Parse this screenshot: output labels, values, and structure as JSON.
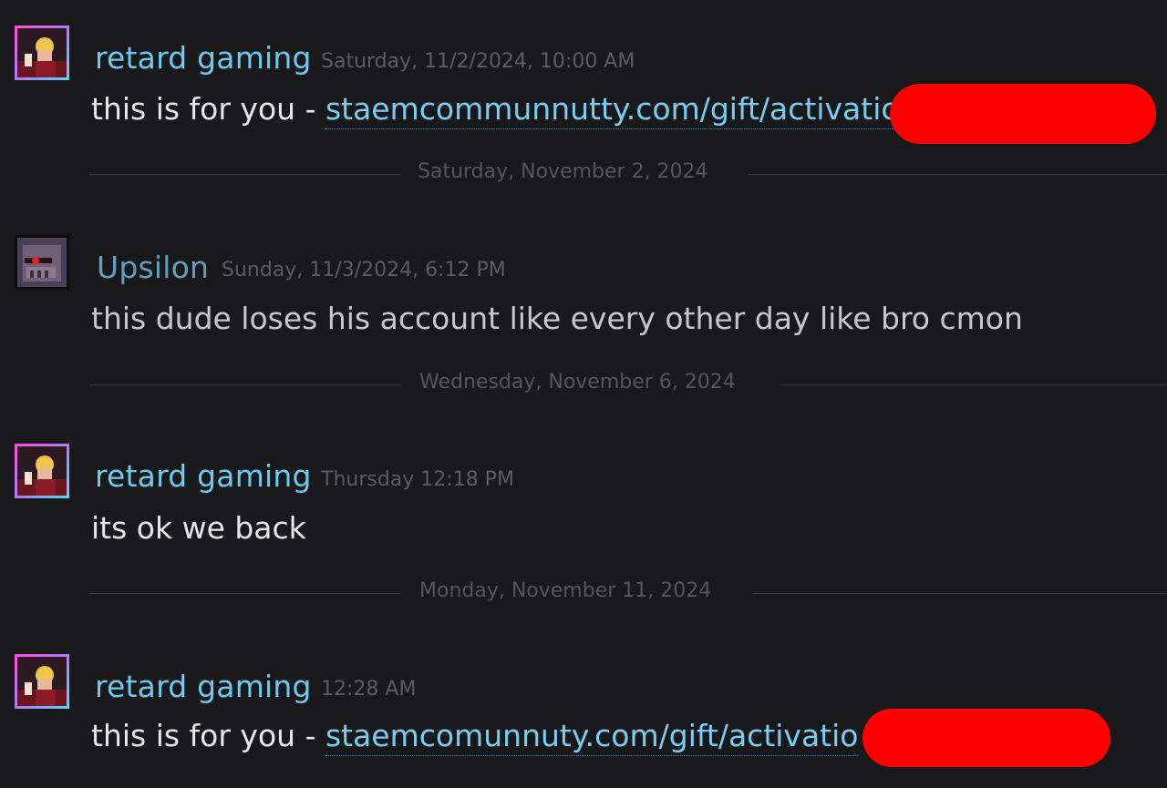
{
  "messages": [
    {
      "author": "retard gaming",
      "time": "Saturday, 11/2/2024, 10:00 AM",
      "prefix": "this is for you - ",
      "link": "staemcommunnutty.com/gift/activatic"
    },
    {
      "author": "Upsilon",
      "time": "Sunday, 11/3/2024, 6:12 PM",
      "text": "this dude loses his account like every other day like bro cmon"
    },
    {
      "author": "retard gaming",
      "time": "Thursday 12:18 PM",
      "text": "its ok we back"
    },
    {
      "author": "retard gaming",
      "time": "12:28 AM",
      "prefix": "this is for you - ",
      "link": "staemcomunnuty.com/gift/activatio"
    }
  ],
  "dividers": [
    "Saturday, November 2, 2024",
    "Wednesday, November 6, 2024",
    "Monday, November 11, 2024"
  ],
  "colors": {
    "background": "#19191b",
    "name": "#6cc9ef",
    "link": "#79cdf2",
    "redaction": "#ff0000"
  }
}
